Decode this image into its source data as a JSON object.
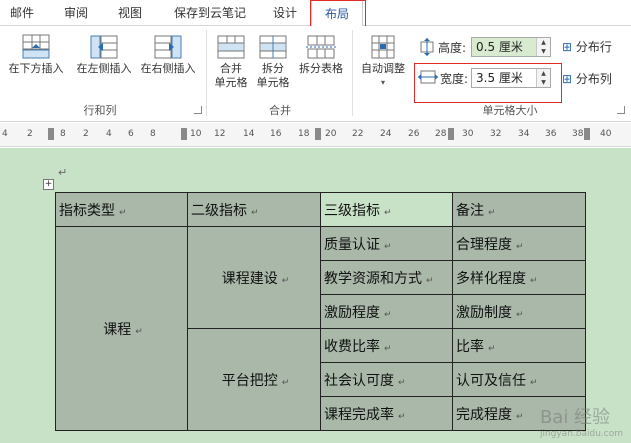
{
  "tabs": [
    {
      "label": "邮件"
    },
    {
      "label": "审阅"
    },
    {
      "label": "视图"
    },
    {
      "label": "保存到云笔记"
    },
    {
      "label": "设计"
    },
    {
      "label": "布局"
    }
  ],
  "active_tab": "布局",
  "ribbon": {
    "rows_cols": {
      "buttons": [
        "在下方插入",
        "在左侧插入",
        "在右侧插入"
      ],
      "group_label": "行和列"
    },
    "merge": {
      "buttons": [
        {
          "line1": "合并",
          "line2": "单元格"
        },
        {
          "line1": "拆分",
          "line2": "单元格"
        },
        {
          "line1": "拆分表格",
          "line2": ""
        }
      ],
      "group_label": "合并"
    },
    "cell_size": {
      "autofit_label": "自动调整",
      "height_label": "高度:",
      "height_value": "0.5 厘米",
      "width_label": "宽度:",
      "width_value": "3.5 厘米",
      "distribute_rows": "分布行",
      "distribute_cols": "分布列",
      "group_label": "单元格大小"
    }
  },
  "ruler": {
    "numbers": [
      "4",
      "2",
      "8",
      "2",
      "4",
      "6",
      "8",
      "10",
      "12",
      "14",
      "16",
      "18",
      "20",
      "22",
      "24",
      "26",
      "28",
      "30",
      "32",
      "34",
      "36",
      "38",
      "40"
    ]
  },
  "table": {
    "headers": [
      "指标类型",
      "二级指标",
      "三级指标",
      "备注"
    ],
    "col1": "课程",
    "groups": [
      {
        "label": "课程建设",
        "items": [
          [
            "质量认证",
            "合理程度"
          ],
          [
            "教学资源和方式",
            "多样化程度"
          ],
          [
            "激励程度",
            "激励制度"
          ]
        ]
      },
      {
        "label": "平台把控",
        "items": [
          [
            "收费比率",
            "比率"
          ],
          [
            "社会认可度",
            "认可及信任"
          ],
          [
            "课程完成率",
            "完成程度"
          ]
        ]
      }
    ]
  },
  "marks": {
    "paragraph": "↵",
    "move": "+"
  },
  "watermark": {
    "title": "Bai 经验",
    "url": "jingyan.baidu.com"
  },
  "colors": {
    "accent_red": "#e02b2b",
    "doc_bg": "#c8e2c8",
    "shade": "#a9b8a9",
    "active_tab_text": "#2b579a"
  }
}
